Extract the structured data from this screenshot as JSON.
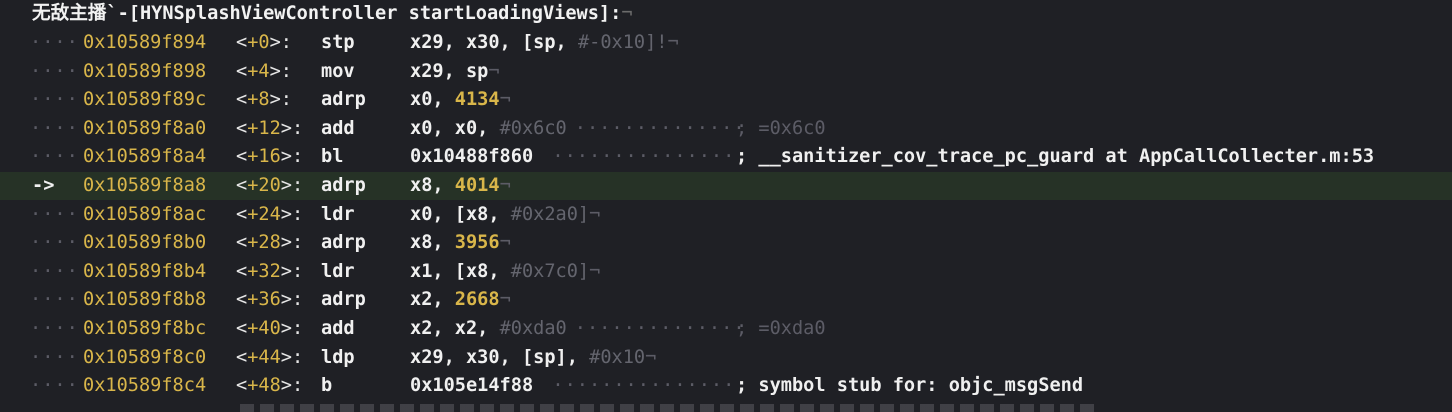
{
  "frame_title": "无敌主播`-[HYNSplashViewController startLoadingViews]:",
  "pc_marker": "->",
  "instructions": [
    {
      "address": "0x10589f894",
      "offset": "+0",
      "mnemonic": "stp",
      "operands": "x29, x30, [sp,",
      "immediate": "#-0x10]!",
      "comment": "",
      "current": false
    },
    {
      "address": "0x10589f898",
      "offset": "+4",
      "mnemonic": "mov",
      "operands": "x29, sp",
      "immediate": "",
      "comment": "",
      "current": false
    },
    {
      "address": "0x10589f89c",
      "offset": "+8",
      "mnemonic": "adrp",
      "operands": "x0,",
      "immediate": "4134",
      "comment": "",
      "current": false
    },
    {
      "address": "0x10589f8a0",
      "offset": "+12",
      "mnemonic": "add",
      "operands": "x0, x0,",
      "immediate": "#0x6c0",
      "comment": "; =0x6c0",
      "current": false
    },
    {
      "address": "0x10589f8a4",
      "offset": "+16",
      "mnemonic": "bl",
      "operands": "0x10488f860",
      "immediate": "",
      "comment": "; __sanitizer_cov_trace_pc_guard at AppCallCollecter.m:53",
      "current": false
    },
    {
      "address": "0x10589f8a8",
      "offset": "+20",
      "mnemonic": "adrp",
      "operands": "x8,",
      "immediate": "4014",
      "comment": "",
      "current": true
    },
    {
      "address": "0x10589f8ac",
      "offset": "+24",
      "mnemonic": "ldr",
      "operands": "x0, [x8,",
      "immediate": "#0x2a0]",
      "comment": "",
      "current": false
    },
    {
      "address": "0x10589f8b0",
      "offset": "+28",
      "mnemonic": "adrp",
      "operands": "x8,",
      "immediate": "3956",
      "comment": "",
      "current": false
    },
    {
      "address": "0x10589f8b4",
      "offset": "+32",
      "mnemonic": "ldr",
      "operands": "x1, [x8,",
      "immediate": "#0x7c0]",
      "comment": "",
      "current": false
    },
    {
      "address": "0x10589f8b8",
      "offset": "+36",
      "mnemonic": "adrp",
      "operands": "x2,",
      "immediate": "2668",
      "comment": "",
      "current": false
    },
    {
      "address": "0x10589f8bc",
      "offset": "+40",
      "mnemonic": "add",
      "operands": "x2, x2,",
      "immediate": "#0xda0",
      "comment": "; =0xda0",
      "current": false
    },
    {
      "address": "0x10589f8c0",
      "offset": "+44",
      "mnemonic": "ldp",
      "operands": "x29, x30, [sp],",
      "immediate": "#0x10",
      "comment": "",
      "current": false
    },
    {
      "address": "0x10589f8c4",
      "offset": "+48",
      "mnemonic": "b",
      "operands": "0x105e14f88",
      "immediate": "",
      "comment": "; symbol stub for: objc_msgSend",
      "current": false
    }
  ],
  "colors": {
    "background": "#1f2025",
    "address": "#d9b64a",
    "current_line": "#263226",
    "whitespace_marker": "#5c5c66"
  }
}
